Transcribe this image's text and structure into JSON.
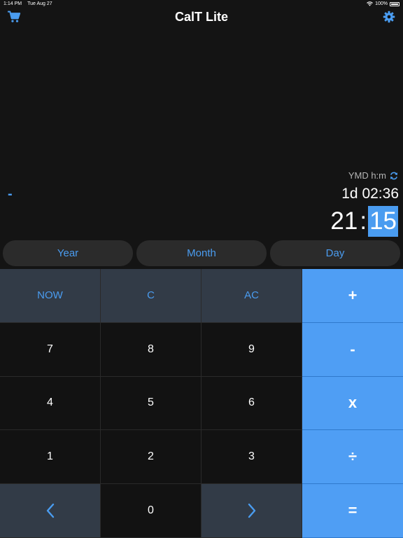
{
  "status_bar": {
    "time": "1:14 PM",
    "date": "Tue Aug 27",
    "battery": "100%"
  },
  "nav": {
    "title": "CalT Lite",
    "left_icon": "cart-icon",
    "right_icon": "gear-icon"
  },
  "display": {
    "mode_label": "YMD h:m",
    "operator": "-",
    "previous_value": "1d 02:36",
    "current_hour": "21",
    "current_separator": ":",
    "current_minute": "15"
  },
  "units": {
    "year": "Year",
    "month": "Month",
    "day": "Day"
  },
  "keys": {
    "now": "NOW",
    "clear": "C",
    "all_clear": "AC",
    "plus": "+",
    "minus": "-",
    "multiply": "x",
    "divide": "÷",
    "equals": "=",
    "seven": "7",
    "eight": "8",
    "nine": "9",
    "four": "4",
    "five": "5",
    "six": "6",
    "one": "1",
    "two": "2",
    "three": "3",
    "zero": "0"
  },
  "colors": {
    "accent": "#4a9cf0",
    "operator_bg": "#4f9ef4",
    "function_bg": "#323b47",
    "background": "#141414"
  }
}
